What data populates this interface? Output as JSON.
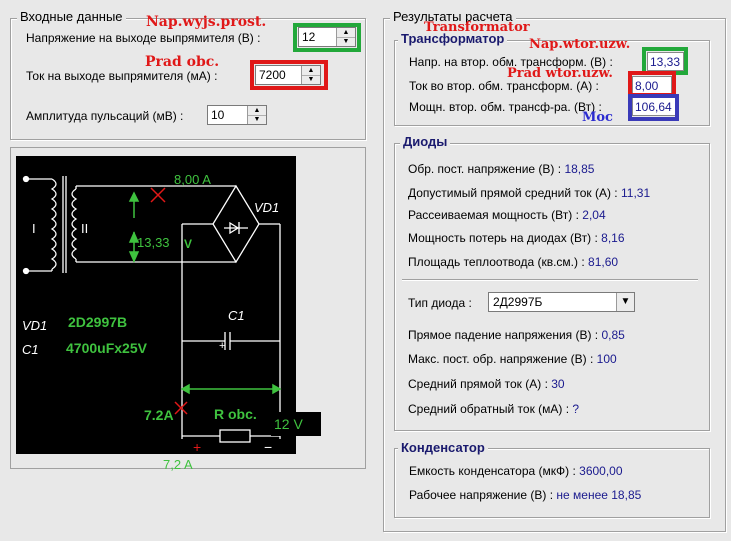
{
  "input": {
    "title": "Входные данные",
    "voltage_label": "Напряжение на выходе выпрямителя (В) :",
    "voltage_value": "12",
    "current_label": "Ток на выходе выпрямителя (мА) :",
    "current_value": "7200",
    "ripple_label": "Амплитуда пульсаций (мВ) :",
    "ripple_value": "10"
  },
  "results": {
    "title": "Результаты расчета",
    "transformer": {
      "title": "Трансформатор",
      "rows": [
        {
          "label": "Напр. на втор. обм. трансформ. (В) :",
          "value": "13,33"
        },
        {
          "label": "Ток во втор. обм. трансформ. (А) :",
          "value": "8,00"
        },
        {
          "label": "Мощн. втор. обм. трансф-ра. (Вт) :",
          "value": "106,64"
        }
      ]
    },
    "diodes": {
      "title": "Диоды",
      "rows": [
        {
          "label": "Обр. пост. напряжение (В) :",
          "value": "18,85"
        },
        {
          "label": "Допустимый прямой средний ток (А) :",
          "value": "11,31"
        },
        {
          "label": "Рассеиваемая мощность (Вт) :",
          "value": "2,04"
        },
        {
          "label": "Мощность потерь на диодах (Вт) :",
          "value": "8,16"
        },
        {
          "label": "Площадь теплоотвода (кв.см.) :",
          "value": "81,60"
        }
      ],
      "type_label": "Тип диода :",
      "type_value": "2Д2997Б",
      "params": [
        {
          "label": "Прямое падение напряжения (В) :",
          "value": "0,85"
        },
        {
          "label": "Макс. пост. обр. напряжение (В) :",
          "value": "100"
        },
        {
          "label": "Средний прямой ток (А) :",
          "value": "30"
        },
        {
          "label": "Средний обратный ток (мА) :",
          "value": "?"
        }
      ]
    },
    "capacitor": {
      "title": "Конденсатор",
      "rows": [
        {
          "label": "Емкость конденсатора (мкФ) :",
          "value": "3600,00"
        },
        {
          "label": "Рабочее напряжение (В) :",
          "value": "не менее 18,85"
        }
      ]
    }
  },
  "annotations": {
    "nap_wyjs_prost": "Nap.wyjs.prost.",
    "prad_obc": "Prad obc.",
    "transformator": "Transformator",
    "nap_wtor_uzw": "Nap.wtor.uzw.",
    "prad_wtor_uzw": "Prad wtor.uzw.",
    "moc": "Moc"
  },
  "schematic": {
    "primary": "I",
    "secondary": "II",
    "current_out": "8,00 A",
    "voltage_secondary": "13,33",
    "voltage_unit": "V",
    "bridge_label": "VD1",
    "cap_label": "C1",
    "vd1_label": "VD1",
    "vd1_value": "2D2997B",
    "c1_label": "C1",
    "c1_value": "4700uFx25V",
    "load_current": "7.2A",
    "load_label": "R obc.",
    "load_voltage": "12 V",
    "plus": "+",
    "minus": "−",
    "plus_small": "+",
    "bottom_current": "7,2 A"
  },
  "colors": {
    "green_text": "#3fc23f",
    "red_anno": "#e01818",
    "blue_anno": "#2b2bd0",
    "box_green": "#22a83a",
    "box_red": "#e01818",
    "box_blue": "#3a3ab8"
  }
}
